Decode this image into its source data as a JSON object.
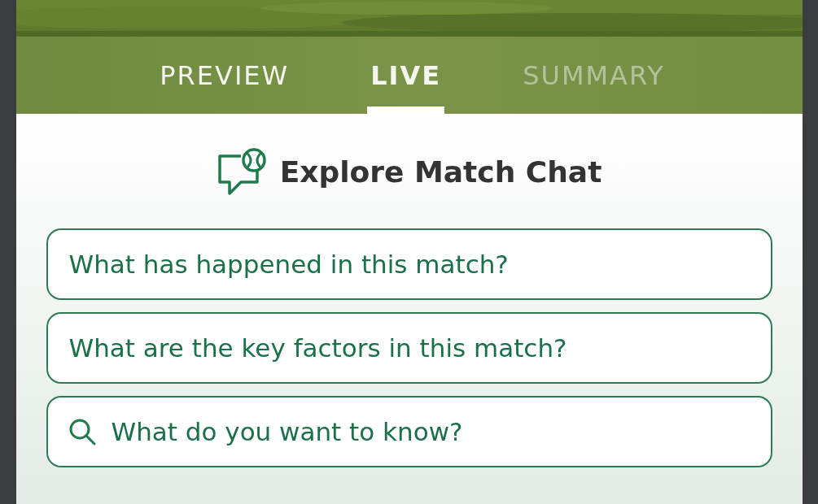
{
  "tabs": [
    {
      "label": "PREVIEW",
      "selected": false,
      "disabled": false
    },
    {
      "label": "LIVE",
      "selected": true,
      "disabled": false
    },
    {
      "label": "SUMMARY",
      "selected": false,
      "disabled": true
    }
  ],
  "chat": {
    "title": "Explore Match Chat",
    "suggestions": [
      "What has happened in this match?",
      "What are the key factors in this match?"
    ],
    "search": {
      "placeholder": "What do you want to know?"
    }
  }
}
